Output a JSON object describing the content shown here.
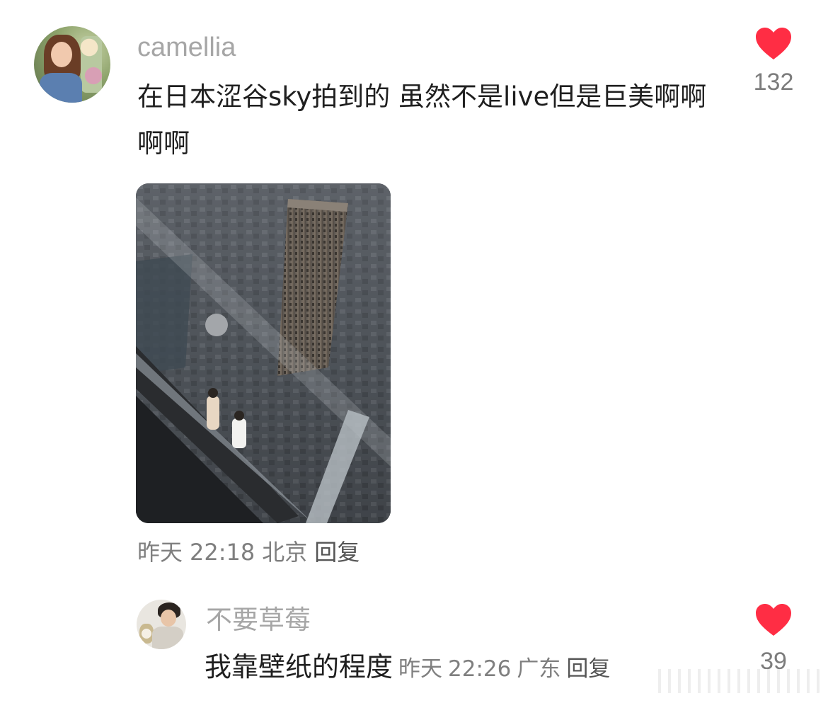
{
  "main_comment": {
    "username": "camellia",
    "text": "在日本涩谷sky拍到的 虽然不是live但是巨美啊啊啊啊",
    "like_count": "132",
    "photo_icon": "photo-image",
    "meta": {
      "date": "昨天",
      "time": "22:18",
      "location": "北京",
      "reply_label": "回复"
    }
  },
  "reply": {
    "username": "不要草莓",
    "text": "我靠壁纸的程度",
    "like_count": "39",
    "meta": {
      "date": "昨天",
      "time": "22:26",
      "location": "广东",
      "reply_label": "回复"
    }
  },
  "icons": {
    "like": "heart-icon"
  },
  "colors": {
    "heart": "#ff2d44",
    "username": "#a6a6a6",
    "meta": "#7f7f7f",
    "text": "#1f1f1f"
  }
}
